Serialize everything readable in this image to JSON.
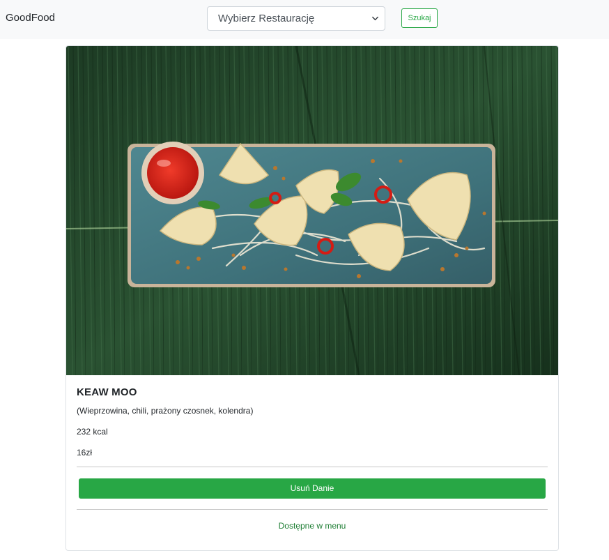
{
  "navbar": {
    "brand": "GoodFood",
    "restaurant_select": {
      "selected": "Wybierz Restaurację"
    },
    "search_label": "Szukaj"
  },
  "dish": {
    "name": "KEAW MOO",
    "description": "(Wieprzowina, chili, prażony czosnek, kolendra)",
    "calories": "232 kcal",
    "price": "16zł",
    "delete_label": "Usuń Danie",
    "availability": "Dostępne w menu"
  },
  "colors": {
    "accent_green": "#28a745",
    "navbar_bg": "#f8f9fa"
  },
  "icons": {
    "select_caret": "chevron-down-icon"
  }
}
